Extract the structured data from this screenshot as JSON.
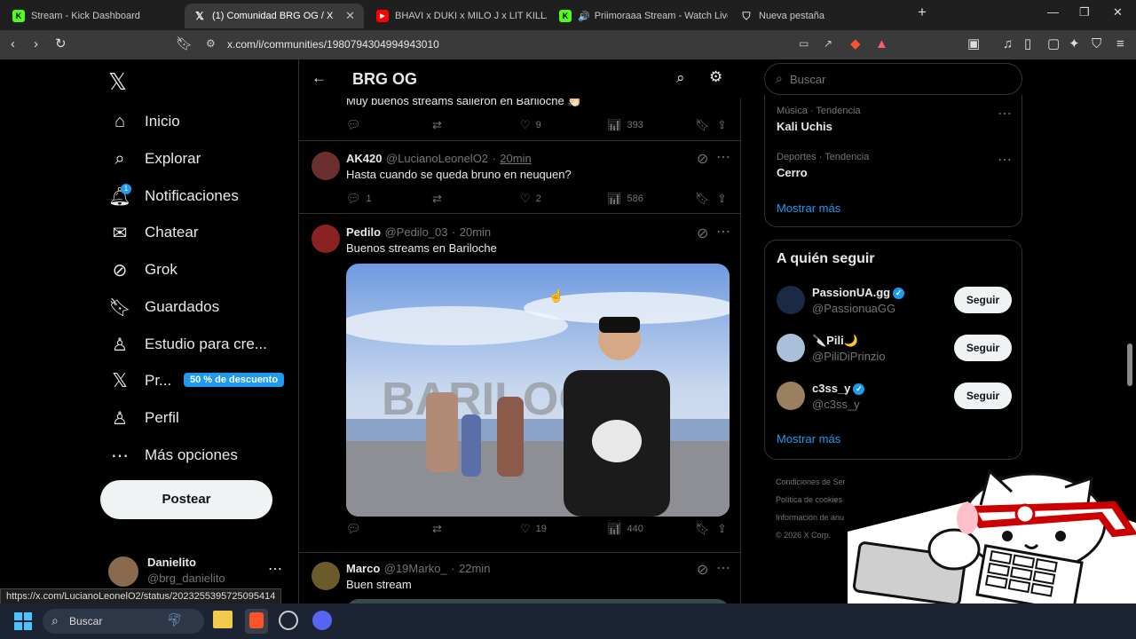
{
  "tabs": [
    {
      "title": "Stream - Kick Dashboard",
      "icon": "kick-icon",
      "color": "#53fc18"
    },
    {
      "title": "(1) Comunidad BRG OG / X",
      "icon": "x-logo-icon",
      "color": "#000000"
    },
    {
      "title": "BHAVI x DUKI x MILO J x LIT KILLAH -",
      "icon": "youtube-icon",
      "color": "#ff0000"
    },
    {
      "title": "Priimoraaa Stream - Watch Live o",
      "icon": "kick-icon",
      "color": "#53fc18"
    },
    {
      "title": "Nueva pestaña",
      "icon": "brave-shield-icon",
      "color": "#cccccc"
    }
  ],
  "address": {
    "url": "x.com/i/communities/1980794304994943010"
  },
  "nav": {
    "items": [
      {
        "label": "Inicio",
        "icon": "home-icon"
      },
      {
        "label": "Explorar",
        "icon": "search-icon"
      },
      {
        "label": "Notificaciones",
        "icon": "bell-icon",
        "badge": "1"
      },
      {
        "label": "Chatear",
        "icon": "mail-icon"
      },
      {
        "label": "Grok",
        "icon": "grok-icon"
      },
      {
        "label": "Guardados",
        "icon": "bookmark-icon"
      },
      {
        "label": "Estudio para cre...",
        "icon": "studio-icon"
      },
      {
        "label": "Pr...",
        "icon": "x-premium-icon"
      },
      {
        "label": "Perfil",
        "icon": "person-icon"
      },
      {
        "label": "Más opciones",
        "icon": "more-circle-icon"
      }
    ],
    "premium_discount": "50 % de descuento",
    "post_label": "Postear",
    "account": {
      "name": "Danielito",
      "handle": "@brg_danielito"
    }
  },
  "timeline": {
    "title": "BRG OG",
    "tweets": [
      {
        "text": "Muy buenos streams salieron en Bariloche 👏🏻",
        "replies": "",
        "reposts": "",
        "likes": "9",
        "views": "393"
      },
      {
        "name": "AK420",
        "handle": "@LucianoLeonelO2",
        "time": "20min",
        "text": "Hasta cuando se queda bruno en neuquen?",
        "replies": "1",
        "reposts": "",
        "likes": "2",
        "views": "586"
      },
      {
        "name": "Pedilo",
        "handle": "@Pedilo_03",
        "time": "20min",
        "text": "Buenos streams en Bariloche",
        "replies": "",
        "reposts": "",
        "likes": "19",
        "views": "440",
        "image_sign": "BARILOC"
      },
      {
        "name": "Marco",
        "handle": "@19Marko_",
        "time": "22min",
        "text": "Buen stream"
      }
    ]
  },
  "right": {
    "search_placeholder": "Buscar",
    "trends": [
      {
        "context": "Música · Tendencia",
        "name": "Kali Uchis"
      },
      {
        "context": "Deportes · Tendencia",
        "name": "Cerro"
      }
    ],
    "show_more": "Mostrar más",
    "who_to_follow_title": "A quién seguir",
    "follow": [
      {
        "name": "PassionUA.gg",
        "handle": "@PassionuaGG",
        "verified": true
      },
      {
        "name": "🔪Pili🌙",
        "handle": "@PiliDiPrinzio",
        "verified": false
      },
      {
        "name": "c3ss_y",
        "handle": "@c3ss_y",
        "verified": true
      }
    ],
    "follow_label": "Seguir",
    "footer": [
      "Condiciones de Ser",
      "Política de cookies",
      "Información de anu",
      "© 2026 X Corp."
    ]
  },
  "statusbar": "https://x.com/LucianoLeonelO2/status/2023255395725095414",
  "taskbar": {
    "search_placeholder": "Buscar"
  },
  "colors": {
    "accent": "#1d9bf0",
    "background": "#000000",
    "border": "#2f3336",
    "muted": "#71767b"
  }
}
